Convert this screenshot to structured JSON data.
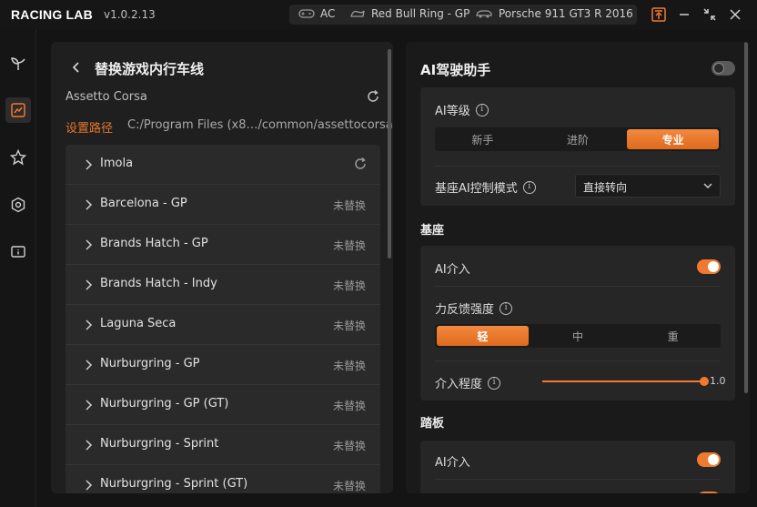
{
  "app": {
    "brand": "RACING LAB",
    "version": "v1.0.2.13"
  },
  "session": {
    "game": "AC",
    "track": "Red Bull Ring - GP",
    "car": "Porsche 911 GT3 R 2016"
  },
  "nav": {
    "items": [
      "sprout-icon",
      "chart-icon",
      "star-icon",
      "settings-icon",
      "info-icon"
    ],
    "active": 1
  },
  "left": {
    "title": "替换游戏内行车线",
    "game": "Assetto Corsa",
    "path_label": "设置路径",
    "path_value": "C:/Program Files (x8…/common/assettocorsa",
    "tracks": [
      {
        "name": "Imola",
        "status": ""
      },
      {
        "name": "Barcelona - GP",
        "status": "未替换"
      },
      {
        "name": "Brands Hatch - GP",
        "status": "未替换"
      },
      {
        "name": "Brands Hatch - Indy",
        "status": "未替换"
      },
      {
        "name": "Laguna Seca",
        "status": "未替换"
      },
      {
        "name": "Nurburgring - GP",
        "status": "未替换"
      },
      {
        "name": "Nurburgring - GP (GT)",
        "status": "未替换"
      },
      {
        "name": "Nurburgring - Sprint",
        "status": "未替换"
      },
      {
        "name": "Nurburgring - Sprint (GT)",
        "status": "未替换"
      }
    ]
  },
  "right": {
    "title": "AI驾驶助手",
    "enabled": false,
    "ai_level": {
      "label": "AI等级",
      "options": [
        "新手",
        "进阶",
        "专业"
      ],
      "selected": 2
    },
    "control_mode": {
      "label": "基座AI控制模式",
      "value": "直接转向"
    },
    "base": {
      "section": "基座",
      "ai_intervene_label": "AI介入",
      "ai_intervene_on": true,
      "ffb_label": "力反馈强度",
      "ffb_options": [
        "轻",
        "中",
        "重"
      ],
      "ffb_selected": 0,
      "degree_label": "介入程度",
      "degree_value": "1.0",
      "degree_fraction": 1.0
    },
    "pedal": {
      "section": "踏板",
      "ai_intervene_label": "AI介入",
      "ai_intervene_on": true
    }
  },
  "colors": {
    "accent": "#ef7a2f",
    "bg": "#141414",
    "panel": "#1f1f1f"
  }
}
